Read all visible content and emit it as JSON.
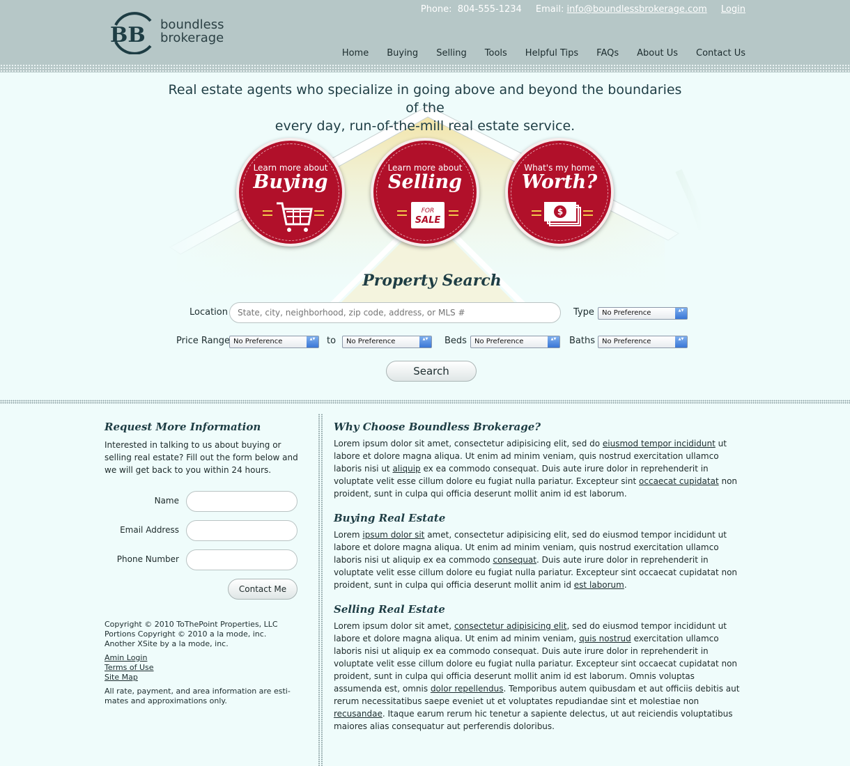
{
  "header": {
    "logo_line1": "boundless",
    "logo_line2": "brokerage",
    "phone_label": "Phone:",
    "phone": "804-555-1234",
    "email_label": "Email:",
    "email": "info@boundlessbrokerage.com",
    "login": "Login",
    "nav": [
      "Home",
      "Buying",
      "Selling",
      "Tools",
      "Helpful Tips",
      "FAQs",
      "About Us",
      "Contact Us"
    ]
  },
  "hero": {
    "tagline_line1": "Real estate agents who specialize in going above and beyond the boundaries of the",
    "tagline_line2": "every day, run-of-the-mill real estate service.",
    "buttons": [
      {
        "small": "Learn more about",
        "big": "Buying",
        "icon": "shopping-cart-icon"
      },
      {
        "small": "Learn more about",
        "big": "Selling",
        "icon": "for-sale-sign-icon",
        "sign_top": "FOR",
        "sign_bottom": "SALE"
      },
      {
        "small": "What's my home",
        "big": "Worth?",
        "icon": "money-stack-icon"
      }
    ]
  },
  "search": {
    "title": "Property Search",
    "location_label": "Location",
    "location_placeholder": "State, city, neighborhood, zip code, address, or MLS #",
    "type_label": "Type",
    "type_value": "No Preference",
    "price_label": "Price Range",
    "price_min": "No Preference",
    "to_label": "to",
    "price_max": "No Preference",
    "beds_label": "Beds",
    "beds_value": "No Preference",
    "baths_label": "Baths",
    "baths_value": "No Preference",
    "button": "Search"
  },
  "request": {
    "title": "Request More Information",
    "intro": "Interested in talking to us about buying or selling real estate? Fill out the form below and we will get back to you within 24 hours.",
    "name_label": "Name",
    "email_label": "Email Address",
    "phone_label": "Phone Number",
    "button": "Contact Me"
  },
  "footer": {
    "copyright1": "Copyright © 2010 ToThePoint Properties, LLC",
    "copyright2": "Portions Copyright © 2010 a la mode, inc.",
    "copyright3": "Another XSite by a la mode, inc.",
    "links": [
      "Amin Login",
      "Terms of Use",
      "Site Map"
    ],
    "disclaimer": "All rate, payment, and area information are esti-mates and approximations only."
  },
  "sections": {
    "why_title": "Why Choose Boundless Brokerage?",
    "why_t1": "Lorem ipsum dolor sit amet, consectetur adipisicing elit, sed do ",
    "why_l1": "eiusmod tempor incididunt",
    "why_t2": " ut labore et dolore magna aliqua. Ut enim ad minim veniam, quis nostrud exercitation ullamco laboris nisi ut ",
    "why_l2": "aliquip",
    "why_t3": " ex ea commodo consequat. Duis aute irure dolor in reprehenderit in voluptate velit esse cillum dolore eu fugiat nulla pariatur. Excepteur sint ",
    "why_l3": "occaecat cupidatat",
    "why_t4": " non proident, sunt in culpa qui officia deserunt mollit anim id est laborum.",
    "buy_title": "Buying Real Estate",
    "buy_t1": "Lorem ",
    "buy_l1": "ipsum dolor sit",
    "buy_t2": " amet, consectetur adipisicing elit, sed do eiusmod tempor incididunt ut labore et dolore magna aliqua. Ut enim ad minim veniam, quis nostrud exercitation ullamco laboris nisi ut aliquip ex ea commodo ",
    "buy_l2": "consequat",
    "buy_t3": ". Duis aute irure dolor in reprehenderit in voluptate velit esse cillum dolore eu fugiat nulla pariatur. Excepteur sint occaecat cupidatat non proident, sunt in culpa qui officia deserunt mollit anim id ",
    "buy_l3": "est laborum",
    "buy_t4": ".",
    "sell_title": "Selling Real Estate",
    "sell_t1": "Lorem ipsum dolor sit amet, ",
    "sell_l1": "consectetur adipisicing elit",
    "sell_t2": ", sed do eiusmod tempor incididunt ut labore et dolore magna aliqua. Ut enim ad minim veniam, ",
    "sell_l2": "quis nostrud",
    "sell_t3": " exercitation ullamco laboris nisi ut aliquip ex ea commodo consequat. Duis aute irure dolor in reprehenderit in voluptate velit esse cillum dolore eu fugiat nulla pariatur. Excepteur sint occaecat cupidatat non proident, sunt in culpa qui officia deserunt mollit anim id est laborum. Omnis voluptas assumenda est, omnis ",
    "sell_l3": "dolor repellendus",
    "sell_t4": ". Temporibus autem quibusdam et aut officiis debitis aut rerum necessitatibus saepe eveniet ut et voluptates repudiandae sint et molestiae non ",
    "sell_l4": "recusandae",
    "sell_t5": ". Itaque earum rerum hic tenetur a sapiente delectus, ut aut reiciendis voluptatibus maiores alias consequatur aut perferendis doloribus."
  },
  "colors": {
    "header_bg": "#b6c7c7",
    "page_bg": "#effcfb",
    "accent_red": "#b1102a",
    "heading": "#1e3d44"
  }
}
